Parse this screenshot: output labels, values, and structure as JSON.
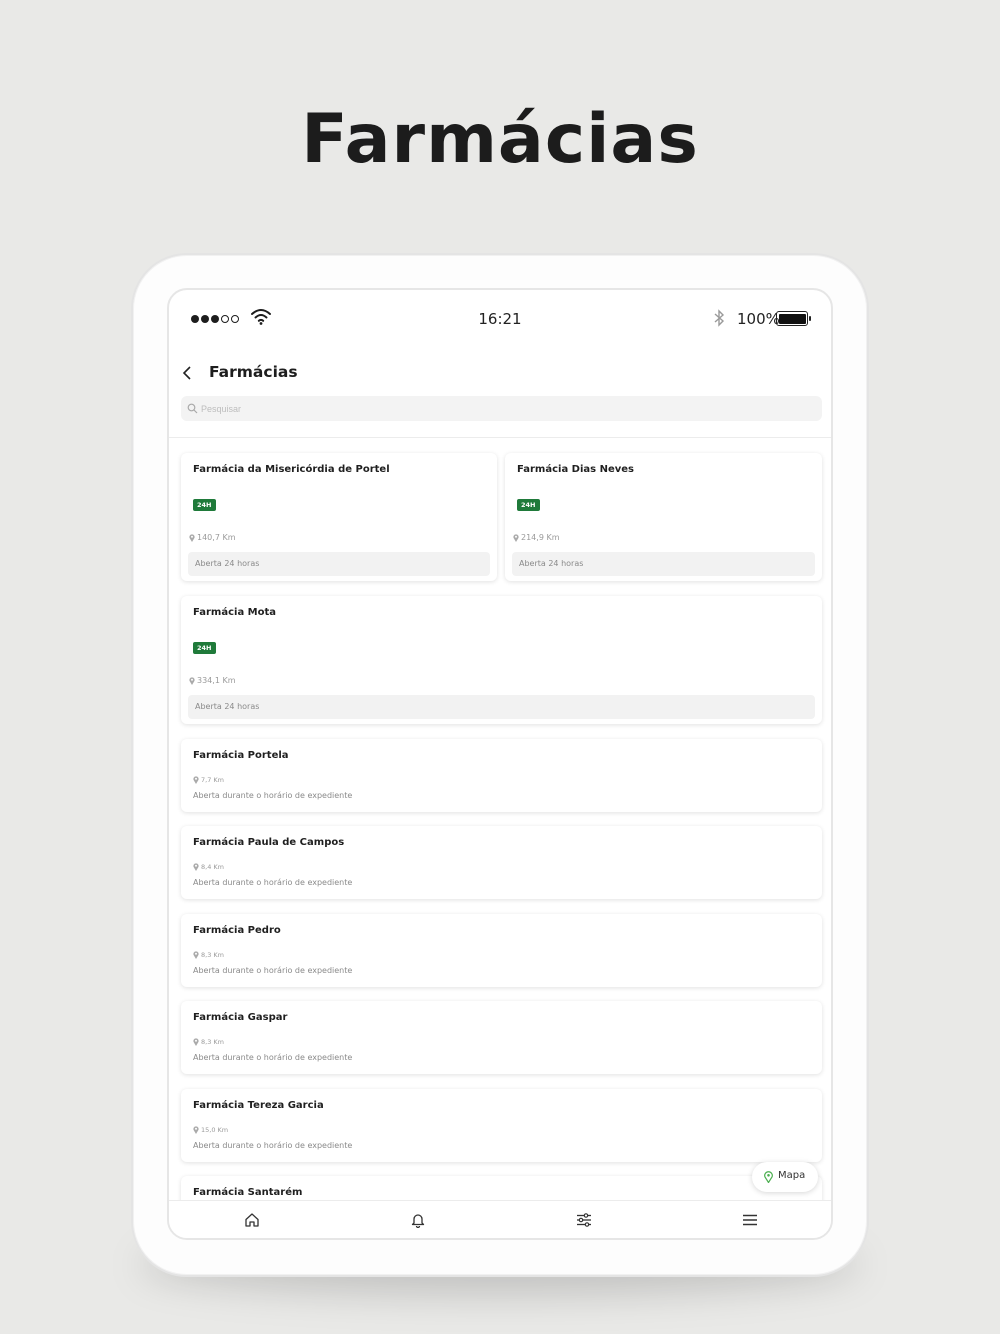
{
  "promo": {
    "title": "Farmácias"
  },
  "status_bar": {
    "time": "16:21",
    "battery": "100%"
  },
  "header": {
    "title": "Farmácias"
  },
  "search": {
    "placeholder": "Pesquisar"
  },
  "pharmacies": [
    {
      "name": "Farmácia da Misericórdia de Portel",
      "badge": "24H",
      "distance": "140,7 Km",
      "hours": "Aberta 24 horas"
    },
    {
      "name": "Farmácia Dias Neves",
      "badge": "24H",
      "distance": "214,9 Km",
      "hours": "Aberta 24 horas"
    },
    {
      "name": "Farmácia Mota",
      "badge": "24H",
      "distance": "334,1 Km",
      "hours": "Aberta 24 horas"
    },
    {
      "name": "Farmácia Portela",
      "distance": "7,7 Km",
      "hours": "Aberta durante o horário de expediente"
    },
    {
      "name": "Farmácia Paula de Campos",
      "distance": "8,4 Km",
      "hours": "Aberta durante o horário de expediente"
    },
    {
      "name": "Farmácia Pedro",
      "distance": "8,3 Km",
      "hours": "Aberta durante o horário de expediente"
    },
    {
      "name": "Farmácia Gaspar",
      "distance": "8,3 Km",
      "hours": "Aberta durante o horário de expediente"
    },
    {
      "name": "Farmácia Tereza Garcia",
      "distance": "15,0 Km",
      "hours": "Aberta durante o horário de expediente"
    },
    {
      "name": "Farmácia Santarém"
    }
  ],
  "map_button": {
    "label": "Mapa"
  },
  "tab_bar": {
    "icons": [
      "home-icon",
      "bell-icon",
      "sliders-icon",
      "menu-icon"
    ]
  },
  "colors": {
    "badge_green": "#1f7a3a",
    "map_pin_green": "#4caf50",
    "background": "#e9e9e7"
  }
}
